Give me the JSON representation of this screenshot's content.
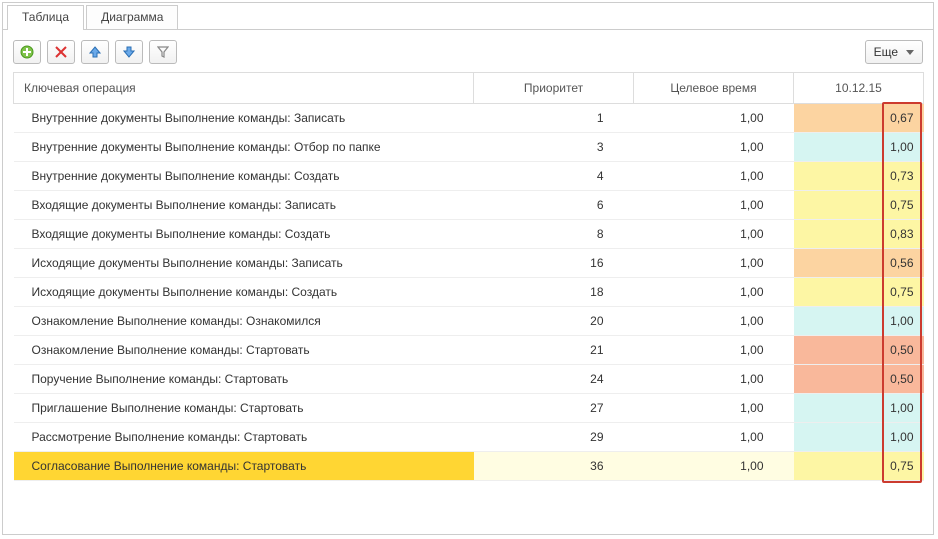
{
  "tabs": {
    "table": "Таблица",
    "diagram": "Диаграмма"
  },
  "toolbar": {
    "more": "Еще"
  },
  "columns": {
    "operation": "Ключевая операция",
    "priority": "Приоритет",
    "target": "Целевое время",
    "date": "10.12.15"
  },
  "rows": [
    {
      "op": "Внутренние документы Выполнение команды: Записать",
      "pr": "1",
      "tv": "1,00",
      "val": "0,67",
      "cls": "val-orange"
    },
    {
      "op": "Внутренние документы Выполнение команды: Отбор по папке",
      "pr": "3",
      "tv": "1,00",
      "val": "1,00",
      "cls": "val-cyan"
    },
    {
      "op": "Внутренние документы Выполнение команды: Создать",
      "pr": "4",
      "tv": "1,00",
      "val": "0,73",
      "cls": "val-yellow"
    },
    {
      "op": "Входящие документы Выполнение команды: Записать",
      "pr": "6",
      "tv": "1,00",
      "val": "0,75",
      "cls": "val-yellow"
    },
    {
      "op": "Входящие документы Выполнение команды: Создать",
      "pr": "8",
      "tv": "1,00",
      "val": "0,83",
      "cls": "val-yellow"
    },
    {
      "op": "Исходящие документы Выполнение команды: Записать",
      "pr": "16",
      "tv": "1,00",
      "val": "0,56",
      "cls": "val-orange"
    },
    {
      "op": "Исходящие документы Выполнение команды: Создать",
      "pr": "18",
      "tv": "1,00",
      "val": "0,75",
      "cls": "val-yellow"
    },
    {
      "op": "Ознакомление Выполнение команды: Ознакомился",
      "pr": "20",
      "tv": "1,00",
      "val": "1,00",
      "cls": "val-cyan"
    },
    {
      "op": "Ознакомление Выполнение команды: Стартовать",
      "pr": "21",
      "tv": "1,00",
      "val": "0,50",
      "cls": "val-red"
    },
    {
      "op": "Поручение Выполнение команды: Стартовать",
      "pr": "24",
      "tv": "1,00",
      "val": "0,50",
      "cls": "val-red"
    },
    {
      "op": "Приглашение Выполнение команды: Стартовать",
      "pr": "27",
      "tv": "1,00",
      "val": "1,00",
      "cls": "val-cyan"
    },
    {
      "op": "Рассмотрение Выполнение команды: Стартовать",
      "pr": "29",
      "tv": "1,00",
      "val": "1,00",
      "cls": "val-cyan"
    },
    {
      "op": "Согласование Выполнение команды: Стартовать",
      "pr": "36",
      "tv": "1,00",
      "val": "0,75",
      "cls": "val-yellow",
      "sel": true
    }
  ]
}
